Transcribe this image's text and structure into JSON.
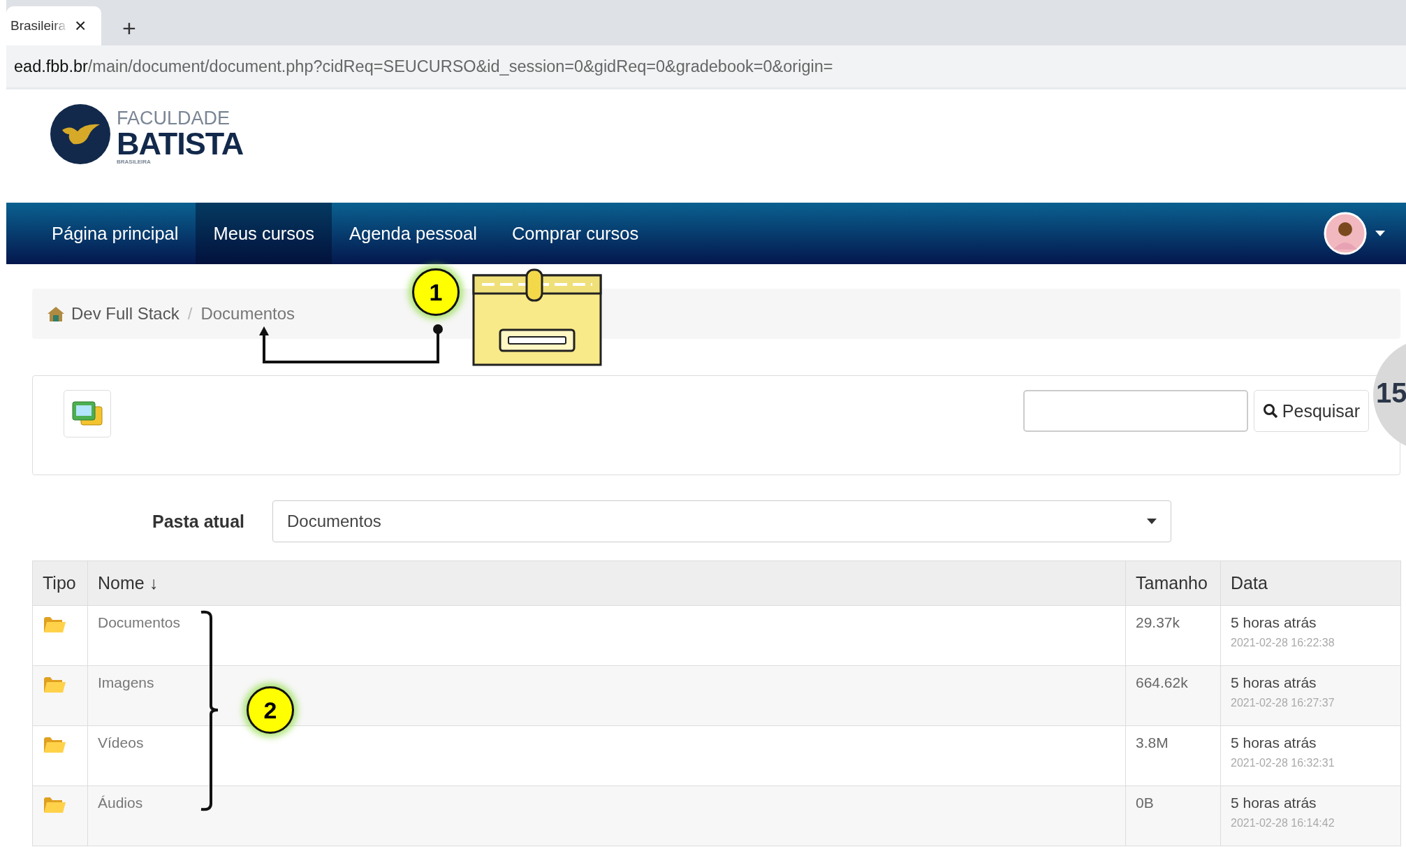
{
  "browser": {
    "tab": {
      "title": "Brasileira",
      "close": "×",
      "selected": true
    },
    "new_tab": "+",
    "url": {
      "host": "ead.fbb.br",
      "path": "/main/document/document.php?cidReq=SEUCURSO&id_session=0&gidReq=0&gradebook=0&origin="
    }
  },
  "logo": {
    "line1": "FACULDADE",
    "line2": "BATISTA",
    "line3": "BRASILEIRA"
  },
  "nav": {
    "items": [
      {
        "label": "Página principal",
        "selected": false
      },
      {
        "label": "Meus cursos",
        "selected": true
      },
      {
        "label": "Agenda pessoal",
        "selected": false
      },
      {
        "label": "Comprar cursos",
        "selected": false
      }
    ]
  },
  "breadcrumb": {
    "items": [
      "Dev Full Stack",
      "Documentos"
    ],
    "separator": "/"
  },
  "toolbar": {
    "search_button": "Pesquisar"
  },
  "badge": "15",
  "current_folder": {
    "label": "Pasta atual",
    "value": "Documentos"
  },
  "table": {
    "columns": [
      "Tipo",
      "Nome ↓",
      "Tamanho",
      "Data"
    ],
    "rows": [
      {
        "name": "Documentos",
        "size": "29.37k",
        "relative": "5 horas atrás",
        "date": "2021-02-28 16:22:38"
      },
      {
        "name": "Imagens",
        "size": "664.62k",
        "relative": "5 horas atrás",
        "date": "2021-02-28 16:27:37"
      },
      {
        "name": "Vídeos",
        "size": "3.8M",
        "relative": "5 horas atrás",
        "date": "2021-02-28 16:32:31"
      },
      {
        "name": "Áudios",
        "size": "0B",
        "relative": "5 horas atrás",
        "date": "2021-02-28 16:14:42"
      }
    ]
  },
  "annotations": [
    {
      "number": "1",
      "kind": "arrow"
    },
    {
      "number": "2",
      "kind": "bracket"
    }
  ]
}
